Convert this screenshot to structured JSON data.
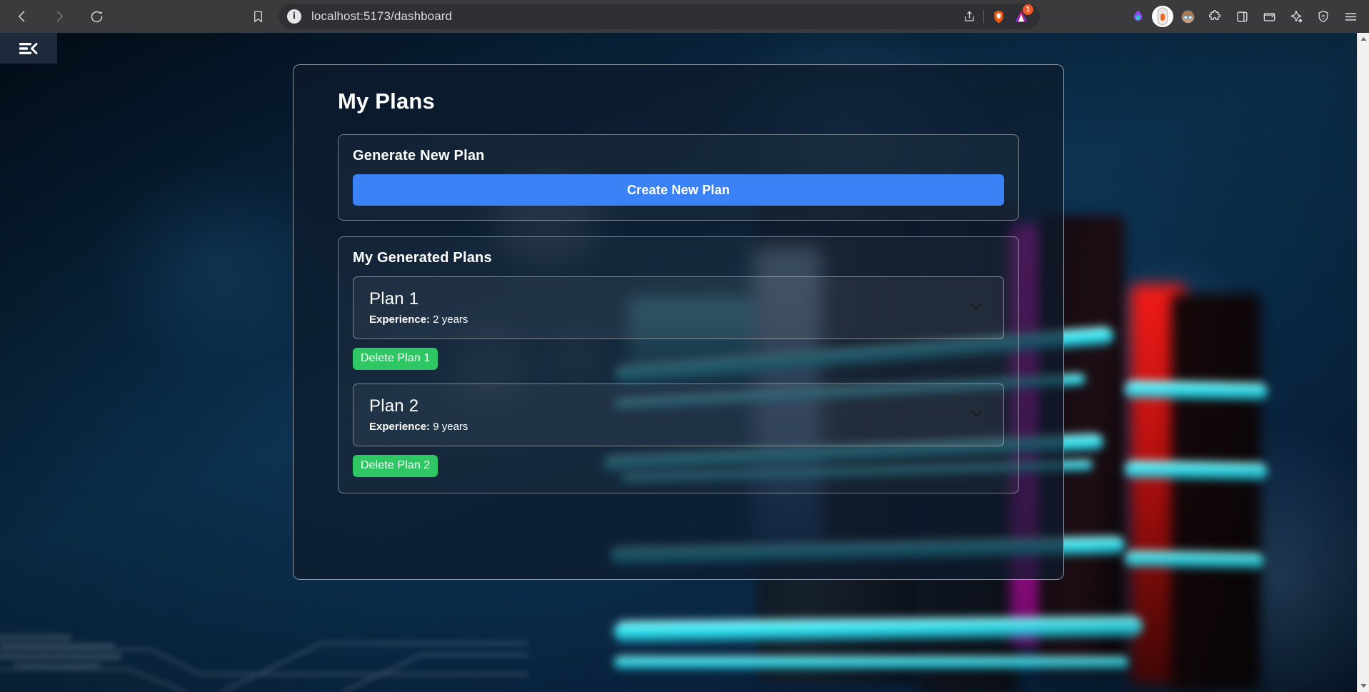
{
  "browser": {
    "url": "localhost:5173/dashboard",
    "nav": {
      "back_label": "Back",
      "forward_label": "Forward",
      "reload_label": "Reload"
    },
    "bookmark_label": "Bookmark this page",
    "site_info_label": "Site information",
    "url_actions": [
      {
        "name": "share-icon",
        "label": "Share"
      },
      {
        "name": "brave-shields-icon",
        "label": "Brave Shields"
      },
      {
        "name": "brave-rewards-icon",
        "label": "Brave Rewards",
        "badge": "1"
      }
    ],
    "extensions": [
      {
        "name": "flame-icon",
        "label": "Flame extension"
      },
      {
        "name": "capsule-avatar-icon",
        "label": "Profile capsule"
      },
      {
        "name": "user-avatar-icon",
        "label": "Account"
      },
      {
        "name": "puzzle-icon",
        "label": "Extensions"
      },
      {
        "name": "sidebar-panel-icon",
        "label": "Sidebar"
      },
      {
        "name": "wallet-icon",
        "label": "Brave Wallet"
      },
      {
        "name": "leo-sparkle-icon",
        "label": "Leo AI"
      },
      {
        "name": "vpn-shield-icon",
        "label": "Brave VPN"
      },
      {
        "name": "hamburger-menu-icon",
        "label": "Customize and control Brave"
      }
    ]
  },
  "app": {
    "sidebar_toggle_label": "Toggle sidebar",
    "page_title": "My Plans",
    "generate_section": {
      "title": "Generate New Plan",
      "create_button": "Create New Plan"
    },
    "plans_section": {
      "title": "My Generated Plans",
      "experience_label": "Experience:",
      "plans": [
        {
          "name": "Plan 1",
          "experience_value": "2 years",
          "delete_label": "Delete Plan 1",
          "expand_icon": "chevron-down-icon"
        },
        {
          "name": "Plan 2",
          "experience_value": "9 years",
          "delete_label": "Delete Plan 2",
          "expand_icon": "chevron-down-icon"
        }
      ]
    }
  },
  "colors": {
    "primary_button": "#3b82f6",
    "delete_button": "#2ec763",
    "card_border": "#ffffff",
    "toolbar_bg": "#3b3b3e",
    "sidebar_tab_bg": "#1e293b"
  }
}
